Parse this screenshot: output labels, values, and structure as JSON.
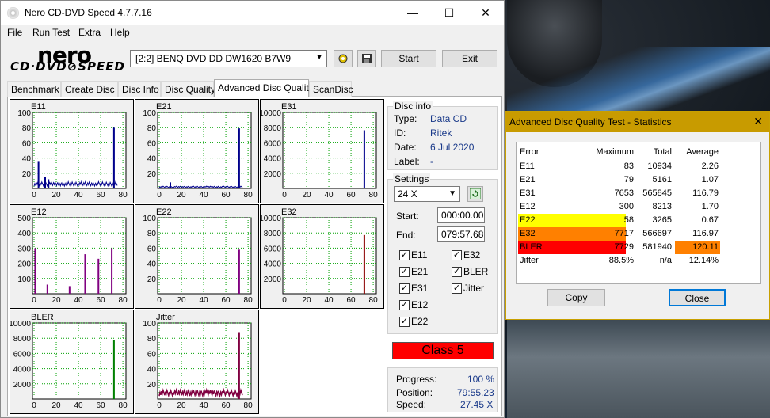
{
  "window": {
    "title": "Nero CD-DVD Speed 4.7.7.16",
    "minimize": "—",
    "maximize": "☐",
    "close": "✕"
  },
  "menu": [
    "File",
    "Run Test",
    "Extra",
    "Help"
  ],
  "logo": {
    "top": "nero",
    "bottom": "CD·DVD⊘SPEED"
  },
  "drive": {
    "selected": "[2:2]   BENQ DVD DD DW1620 B7W9"
  },
  "toolbar": {
    "start": "Start",
    "exit": "Exit"
  },
  "tabs": [
    "Benchmark",
    "Create Disc",
    "Disc Info",
    "Disc Quality",
    "Advanced Disc Quality",
    "ScanDisc"
  ],
  "active_tab": "Advanced Disc Quality",
  "graphs": [
    {
      "name": "E11",
      "ymax": 100,
      "yticks": [
        "100",
        "80",
        "60",
        "40",
        "20"
      ],
      "color": "#00008b"
    },
    {
      "name": "E21",
      "ymax": 100,
      "yticks": [
        "100",
        "80",
        "60",
        "40",
        "20"
      ],
      "color": "#00008b"
    },
    {
      "name": "E31",
      "ymax": 10000,
      "yticks": [
        "10000",
        "8000",
        "6000",
        "4000",
        "2000"
      ],
      "color": "#00008b"
    },
    {
      "name": "E12",
      "ymax": 500,
      "yticks": [
        "500",
        "400",
        "300",
        "200",
        "100"
      ],
      "color": "#800080"
    },
    {
      "name": "E22",
      "ymax": 100,
      "yticks": [
        "100",
        "80",
        "60",
        "40",
        "20"
      ],
      "color": "#800080"
    },
    {
      "name": "E32",
      "ymax": 10000,
      "yticks": [
        "10000",
        "8000",
        "6000",
        "4000",
        "2000"
      ],
      "color": "#8b0000"
    },
    {
      "name": "BLER",
      "ymax": 10000,
      "yticks": [
        "10000",
        "8000",
        "6000",
        "4000",
        "2000"
      ],
      "color": "#008000"
    },
    {
      "name": "Jitter",
      "ymax": 100,
      "yticks": [
        "100",
        "80",
        "60",
        "40",
        "20"
      ],
      "color": "#800040"
    }
  ],
  "xticks": [
    "0",
    "20",
    "40",
    "60",
    "80"
  ],
  "chart_data": {
    "type": "bar",
    "note_x": "minutes",
    "E11_spikes": [
      [
        4,
        35
      ],
      [
        10,
        15
      ],
      [
        13,
        12
      ],
      [
        72,
        80
      ]
    ],
    "E11_baseline": 6,
    "E21_spikes": [
      [
        72,
        79
      ],
      [
        10,
        8
      ]
    ],
    "E31_spikes": [
      [
        72,
        7653
      ]
    ],
    "E12_spikes": [
      [
        1,
        300
      ],
      [
        46,
        260
      ],
      [
        58,
        230
      ],
      [
        70,
        300
      ],
      [
        12,
        60
      ],
      [
        32,
        50
      ]
    ],
    "E22_spikes": [
      [
        72,
        58
      ]
    ],
    "E32_spikes": [
      [
        72,
        7717
      ]
    ],
    "BLER_spikes": [
      [
        72,
        7729
      ]
    ],
    "Jitter_baseline": 8,
    "Jitter_spikes": [
      [
        72,
        88
      ]
    ]
  },
  "disc_info": {
    "legend": "Disc info",
    "type_label": "Type:",
    "type": "Data CD",
    "id_label": "ID:",
    "id": "Ritek",
    "date_label": "Date:",
    "date": "6 Jul 2020",
    "label_label": "Label:",
    "label": "-"
  },
  "settings": {
    "legend": "Settings",
    "speed": "24 X",
    "start_label": "Start:",
    "start": "000:00.00",
    "end_label": "End:",
    "end": "079:57.68",
    "checks_left": [
      "E11",
      "E21",
      "E31",
      "E12",
      "E22"
    ],
    "checks_right": [
      "E32",
      "BLER",
      "Jitter"
    ]
  },
  "class_label": "Class 5",
  "progress": {
    "progress_label": "Progress:",
    "progress": "100 %",
    "position_label": "Position:",
    "position": "79:55.23",
    "speed_label": "Speed:",
    "speed": "27.45 X"
  },
  "stats_dialog": {
    "title": "Advanced Disc Quality Test - Statistics",
    "close": "✕",
    "headers": [
      "Error",
      "Maximum",
      "Total",
      "Average"
    ],
    "rows": [
      {
        "error": "E11",
        "max": "83",
        "total": "10934",
        "avg": "2.26"
      },
      {
        "error": "E21",
        "max": "79",
        "total": "5161",
        "avg": "1.07"
      },
      {
        "error": "E31",
        "max": "7653",
        "total": "565845",
        "avg": "116.79"
      },
      {
        "error": "E12",
        "max": "300",
        "total": "8213",
        "avg": "1.70"
      },
      {
        "error": "E22",
        "max": "58",
        "total": "3265",
        "avg": "0.67"
      },
      {
        "error": "E32",
        "max": "7717",
        "total": "566697",
        "avg": "116.97"
      },
      {
        "error": "BLER",
        "max": "7729",
        "total": "581940",
        "avg": "120.11"
      },
      {
        "error": "Jitter",
        "max": "88.5%",
        "total": "n/a",
        "avg": "12.14%"
      }
    ],
    "colors": {
      "e22": "#ffff00",
      "e32": "#ff8000",
      "bler": "#ff0000",
      "bler_avg": "#ff8000"
    },
    "copy": "Copy",
    "close_btn": "Close"
  }
}
